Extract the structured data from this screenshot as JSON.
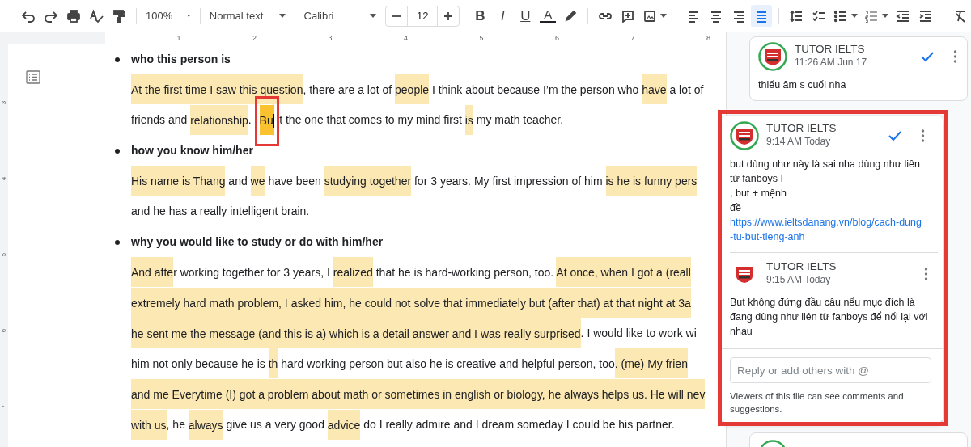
{
  "toolbar": {
    "zoom": "100%",
    "style": "Normal text",
    "font": "Calibri",
    "font_size": "12",
    "format_buttons": [
      {
        "label": "B",
        "kind": "bold"
      },
      {
        "label": "I",
        "kind": "italic"
      },
      {
        "label": "U",
        "kind": "underline"
      },
      {
        "label": "A",
        "kind": "color"
      }
    ],
    "align": [
      {
        "kind": "left",
        "selected": false
      },
      {
        "kind": "center",
        "selected": false
      },
      {
        "kind": "right",
        "selected": false
      },
      {
        "kind": "justify",
        "selected": true
      }
    ]
  },
  "ruler": [
    "1",
    "2",
    "3",
    "4",
    "5",
    "6",
    "7",
    "8"
  ],
  "vertical_ruler": [
    "3",
    "4",
    "5",
    "6",
    "7"
  ],
  "document": [
    {
      "kind": "bullet",
      "text": "who this person is"
    },
    {
      "kind": "line",
      "segments": [
        {
          "text": "At the first time I saw this question",
          "highlighted": true
        },
        {
          "text": ", there are a lot of ",
          "highlighted": false
        },
        {
          "text": "people",
          "highlighted": true
        },
        {
          "text": " I think about because I’m the person who ",
          "highlighted": false
        },
        {
          "text": "have",
          "highlighted": true
        },
        {
          "text": " a lot of",
          "highlighted": false
        }
      ]
    },
    {
      "kind": "line",
      "segments": [
        {
          "text": "friends and ",
          "highlighted": false
        },
        {
          "text": "relationship",
          "highlighted": true
        },
        {
          "text": ". ",
          "highlighted": false
        },
        {
          "text": "Bu",
          "highlighted": true,
          "current": true,
          "cursor": true,
          "circled": true
        },
        {
          "text": "t the one that comes to my mind first ",
          "highlighted": false
        },
        {
          "text": "is",
          "highlighted": true
        },
        {
          "text": " my math teacher.",
          "highlighted": false
        }
      ]
    },
    {
      "kind": "bullet",
      "text": "how you know him/her"
    },
    {
      "kind": "line",
      "segments": [
        {
          "text": "His name is Thang",
          "highlighted": true
        },
        {
          "text": " and ",
          "highlighted": false
        },
        {
          "text": "we",
          "highlighted": true
        },
        {
          "text": " have been ",
          "highlighted": false
        },
        {
          "text": "studying together",
          "highlighted": true
        },
        {
          "text": " for 3 years. My first impression of him ",
          "highlighted": false
        },
        {
          "text": "is he is funny pers",
          "highlighted": true
        }
      ]
    },
    {
      "kind": "line",
      "segments": [
        {
          "text": "and he has a really intelligent brain.",
          "highlighted": false
        }
      ]
    },
    {
      "kind": "bullet",
      "text": "why you would like to study or do with him/her"
    },
    {
      "kind": "line",
      "segments": [
        {
          "text": " And afte",
          "highlighted": true
        },
        {
          "text": "r working together for 3 years, I ",
          "highlighted": false
        },
        {
          "text": "realized",
          "highlighted": true
        },
        {
          "text": " that he is hard-working person, too. ",
          "highlighted": false
        },
        {
          "text": "At once, when I got a (reall",
          "highlighted": true
        }
      ]
    },
    {
      "kind": "line",
      "segments": [
        {
          "text": "extremely hard math problem, I asked him, he could not solve that immediately but (after that) at that night at 3a",
          "highlighted": true
        }
      ]
    },
    {
      "kind": "line",
      "segments": [
        {
          "text": "he sent me the message (and this is a) which is a detail answer and I was really surprised",
          "highlighted": true
        },
        {
          "text": ". I would like to work wi",
          "highlighted": false
        }
      ]
    },
    {
      "kind": "line",
      "segments": [
        {
          "text": "him not only because he is ",
          "highlighted": false
        },
        {
          "text": "th",
          "highlighted": true
        },
        {
          "text": " hard working person but also he is creative and helpful person, too",
          "highlighted": false
        },
        {
          "text": ". (me) My frien",
          "highlighted": true
        }
      ]
    },
    {
      "kind": "line",
      "segments": [
        {
          "text": "and me Everytime (I) got a problem about math or sometimes in english or biology, he always helps us. He will nev",
          "highlighted": true
        }
      ]
    },
    {
      "kind": "line",
      "segments": [
        {
          "text": "with us",
          "highlighted": true
        },
        {
          "text": ", he ",
          "highlighted": false
        },
        {
          "text": "always",
          "highlighted": true
        },
        {
          "text": " give us a very good ",
          "highlighted": false
        },
        {
          "text": "advice",
          "highlighted": true
        },
        {
          "text": " do I really admire and I dream someday I could be his partner.",
          "highlighted": false
        }
      ]
    }
  ],
  "threads": [
    {
      "active": false,
      "circled": false,
      "comments": [
        {
          "author": "TUTOR IELTS",
          "time": "11:26 AM Jun 17",
          "avatar_ring": true,
          "resolve": true,
          "text": "thiếu âm s cuối nha"
        }
      ]
    },
    {
      "active": true,
      "circled": true,
      "comments": [
        {
          "author": "TUTOR IELTS",
          "time": "9:14 AM Today",
          "avatar_ring": true,
          "resolve": true,
          "text": "but dùng như này là sai nha dùng như liên từ fanboys í\n, but + mệnh\nđề ",
          "link": "https://www.ieltsdanang.vn/blog/cach-dung-tu-but-tieng-anh"
        },
        {
          "author": "TUTOR IELTS",
          "time": "9:15 AM Today",
          "avatar_ring": false,
          "resolve": false,
          "text": "But không đứng đầu câu nếu mục đích là đang dùng như liên từ fanboys để nối lại với nhau"
        }
      ],
      "reply_placeholder": "Reply or add others with @",
      "footer": "Viewers of this file can see comments and suggestions."
    }
  ]
}
